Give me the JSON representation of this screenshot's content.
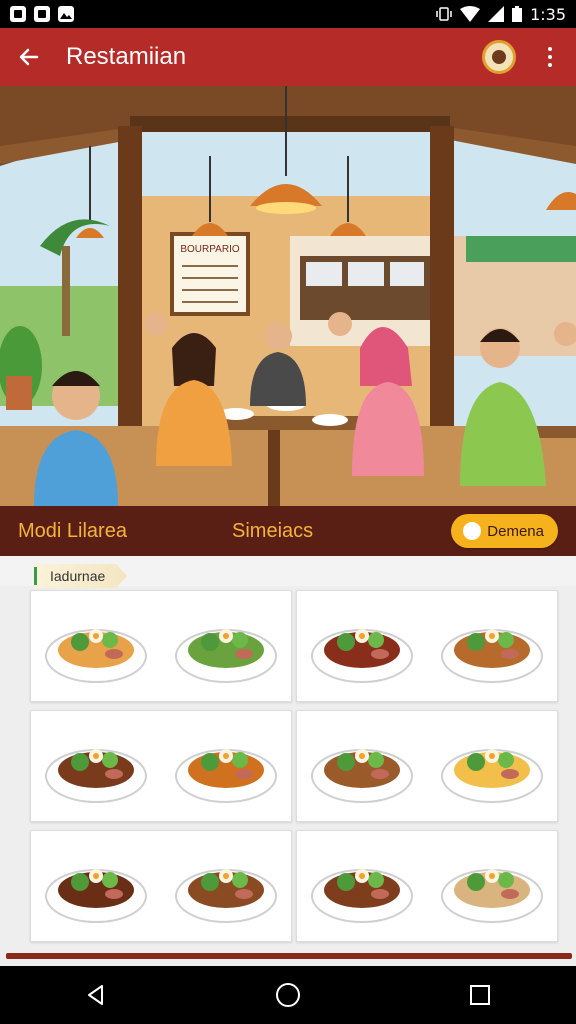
{
  "status_bar": {
    "time": "1:35",
    "left_icons": [
      "notification-icon",
      "app-notification-icon",
      "image-notification-icon"
    ],
    "right_icons": [
      "vibrate-icon",
      "wifi-icon",
      "signal-icon",
      "battery-icon"
    ]
  },
  "app_bar": {
    "title": "Restamiian",
    "back_icon": "arrow-left-icon",
    "profile_icon": "restaurant-logo-avatar",
    "menu_icon": "more-vert-icon"
  },
  "hero": {
    "menu_board_title": "BOURPARIO",
    "description_icon": "restaurant-interior-illustration"
  },
  "band": {
    "left_label": "Modi Lilarea",
    "middle_label": "Simeiacs",
    "button_label": "Demena",
    "button_icon": "flower-icon"
  },
  "section": {
    "label": "Iadurnae"
  },
  "dishes": [
    {
      "name": "dish-1a",
      "accent": "#e8a24a"
    },
    {
      "name": "dish-1b",
      "accent": "#6aa23e"
    },
    {
      "name": "dish-2a",
      "accent": "#8a2e1c"
    },
    {
      "name": "dish-2b",
      "accent": "#b66a2c"
    },
    {
      "name": "dish-3a",
      "accent": "#7a3a1c"
    },
    {
      "name": "dish-3b",
      "accent": "#d0711f"
    },
    {
      "name": "dish-4a",
      "accent": "#9a5a2a"
    },
    {
      "name": "dish-4b",
      "accent": "#f2c04a"
    },
    {
      "name": "dish-5a",
      "accent": "#6a2e16"
    },
    {
      "name": "dish-5b",
      "accent": "#8a4a22"
    },
    {
      "name": "dish-6a",
      "accent": "#7e3e1e"
    },
    {
      "name": "dish-6b",
      "accent": "#d9b47e"
    }
  ],
  "nav_bar": {
    "icons": [
      "back-triangle-icon",
      "home-circle-icon",
      "recents-square-icon"
    ]
  },
  "colors": {
    "app_bar": "#b52b27",
    "band": "#5a1f14",
    "band_text": "#f3b33d",
    "button": "#f6b21c"
  }
}
